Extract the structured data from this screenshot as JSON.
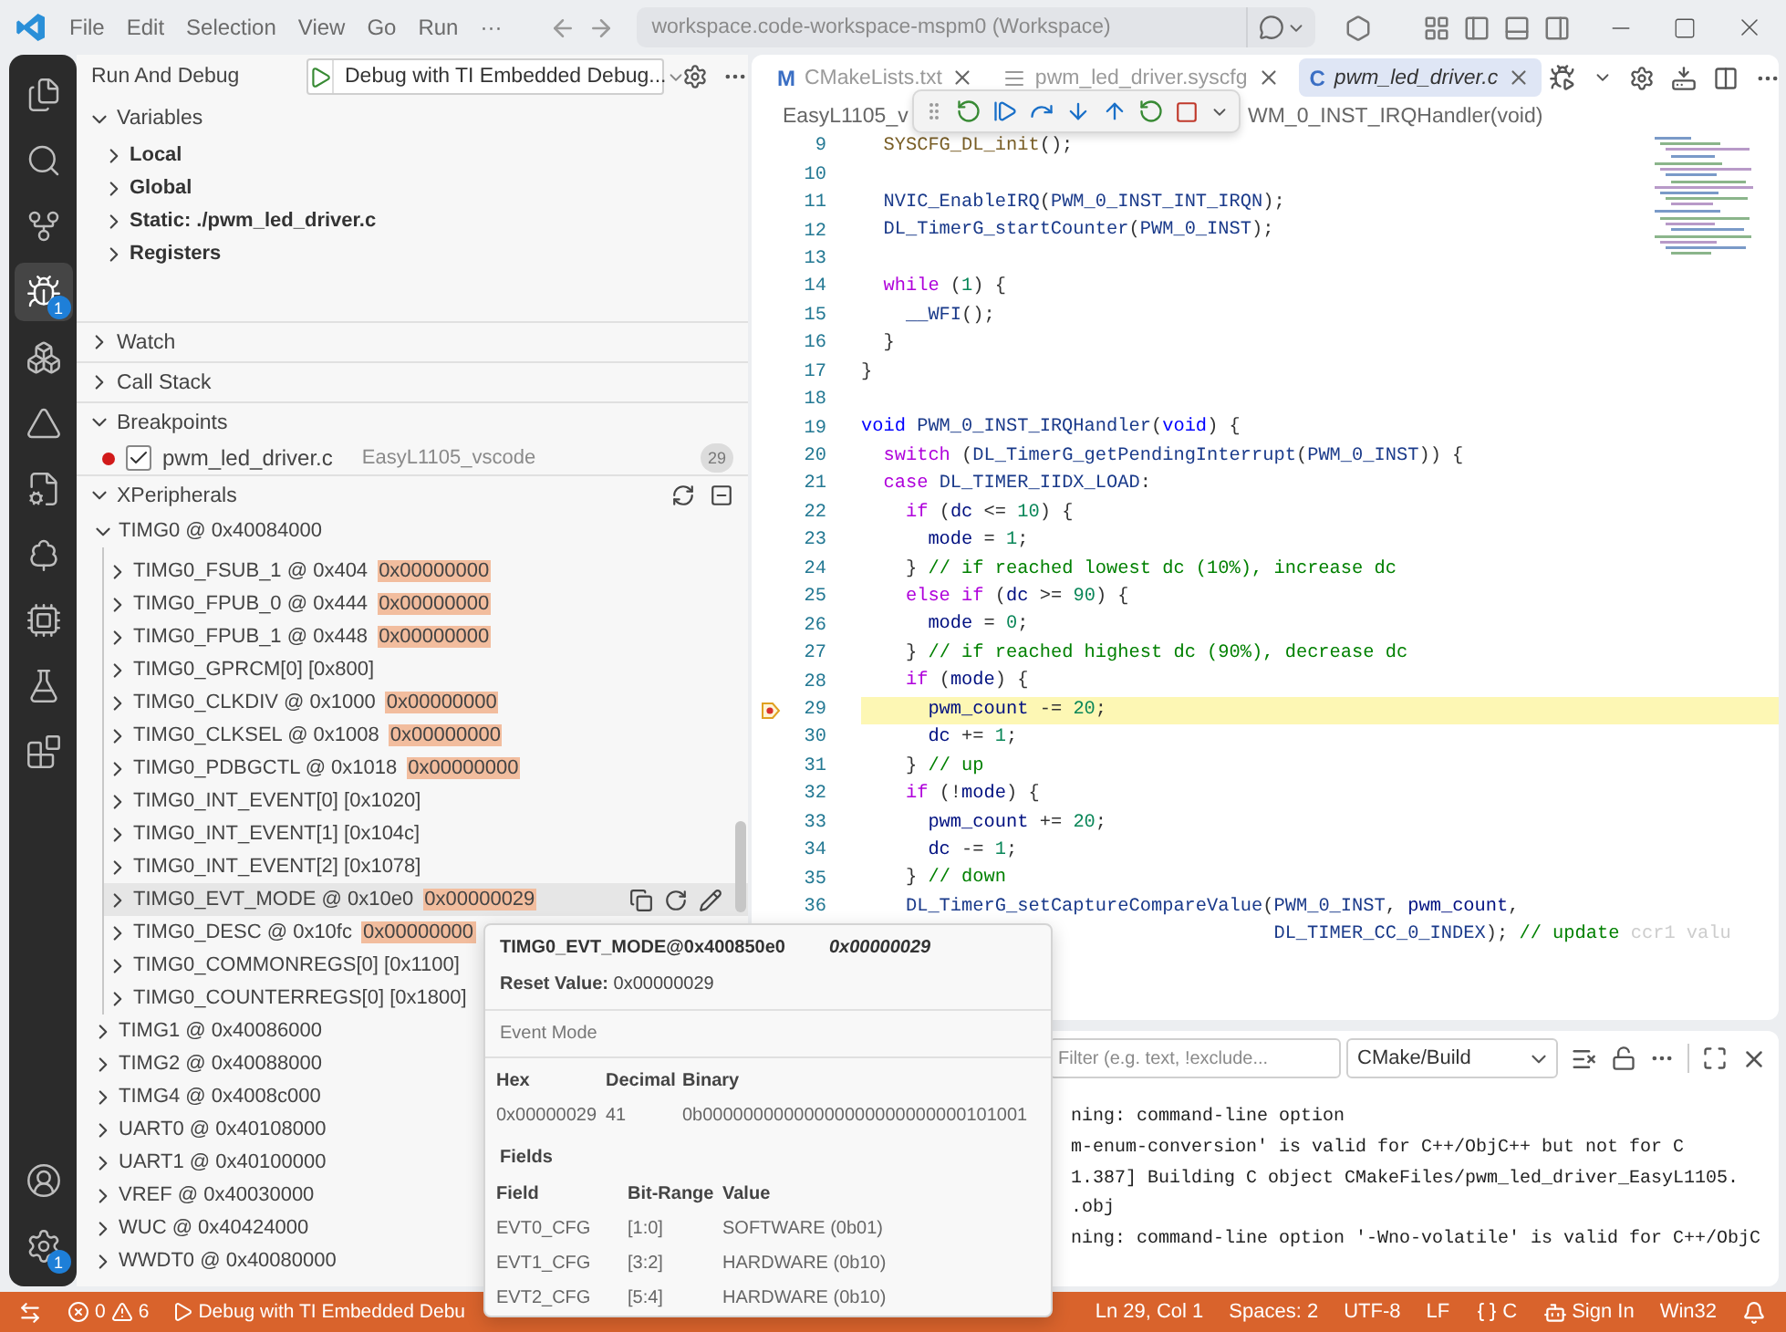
{
  "title_bar": {
    "menus": [
      "File",
      "Edit",
      "Selection",
      "View",
      "Go",
      "Run",
      "···"
    ],
    "command_center": "workspace.code-workspace-mspm0 (Workspace)"
  },
  "activity_bar": {
    "top": [
      {
        "selected": false
      },
      {
        "selected": false
      },
      {
        "selected": false
      },
      {
        "selected": true,
        "badge": "1"
      },
      {
        "selected": false
      },
      {
        "selected": false
      },
      {
        "selected": false
      },
      {
        "selected": false
      },
      {
        "selected": false
      },
      {
        "selected": false
      },
      {
        "selected": false
      }
    ],
    "bottom": [
      {
        "selected": false
      },
      {
        "selected": false,
        "badge": "1"
      }
    ]
  },
  "sidebar": {
    "title": "Run And Debug",
    "launch_config": "Debug with TI Embedded Debug...",
    "variables": {
      "title": "Variables",
      "expanded": true,
      "items": [
        {
          "label": "Local",
          "expanded": false
        },
        {
          "label": "Global",
          "expanded": false
        },
        {
          "label": "Static: ./pwm_led_driver.c",
          "expanded": false
        },
        {
          "label": "Registers",
          "expanded": false
        }
      ]
    },
    "watch": {
      "title": "Watch",
      "expanded": false
    },
    "call_stack": {
      "title": "Call Stack",
      "expanded": false
    },
    "breakpoints": {
      "title": "Breakpoints",
      "expanded": true,
      "items": [
        {
          "file": "pwm_led_driver.c",
          "folder": "EasyL1105_vscode",
          "count": "29",
          "checked": true
        }
      ]
    },
    "xperipherals": {
      "title": "XPeripherals",
      "expanded": true,
      "items": [
        {
          "label": "TIMG0 @ 0x40084000",
          "expanded": true,
          "children": [
            {
              "label": "TIMG0_FSUB_1 @ 0x404",
              "value": "0x00000000",
              "expanded": false,
              "hovered": false
            },
            {
              "label": "TIMG0_FPUB_0 @ 0x444",
              "value": "0x00000000",
              "expanded": false,
              "hovered": false
            },
            {
              "label": "TIMG0_FPUB_1 @ 0x448",
              "value": "0x00000000",
              "expanded": false,
              "hovered": false
            },
            {
              "label": "TIMG0_GPRCM[0] [0x800]",
              "expanded": false,
              "hovered": false
            },
            {
              "label": "TIMG0_CLKDIV @ 0x1000",
              "value": "0x00000000",
              "expanded": false,
              "hovered": false
            },
            {
              "label": "TIMG0_CLKSEL @ 0x1008",
              "value": "0x00000000",
              "expanded": false,
              "hovered": false
            },
            {
              "label": "TIMG0_PDBGCTL @ 0x1018",
              "value": "0x00000000",
              "expanded": false,
              "hovered": false
            },
            {
              "label": "TIMG0_INT_EVENT[0] [0x1020]",
              "expanded": false,
              "hovered": false
            },
            {
              "label": "TIMG0_INT_EVENT[1] [0x104c]",
              "expanded": false,
              "hovered": false
            },
            {
              "label": "TIMG0_INT_EVENT[2] [0x1078]",
              "expanded": false,
              "hovered": false
            },
            {
              "label": "TIMG0_EVT_MODE @ 0x10e0",
              "value": "0x00000029",
              "expanded": false,
              "hovered": true
            },
            {
              "label": "TIMG0_DESC @ 0x10fc",
              "value": "0x00000000",
              "expanded": false,
              "hovered": false
            },
            {
              "label": "TIMG0_COMMONREGS[0] [0x1100]",
              "expanded": false,
              "hovered": false
            },
            {
              "label": "TIMG0_COUNTERREGS[0] [0x1800]",
              "expanded": false,
              "hovered": false
            }
          ]
        },
        {
          "label": "TIMG1 @ 0x40086000",
          "expanded": false
        },
        {
          "label": "TIMG2 @ 0x40088000",
          "expanded": false
        },
        {
          "label": "TIMG4 @ 0x4008c000",
          "expanded": false
        },
        {
          "label": "UART0 @ 0x40108000",
          "expanded": false
        },
        {
          "label": "UART1 @ 0x40100000",
          "expanded": false
        },
        {
          "label": "VREF @ 0x40030000",
          "expanded": false
        },
        {
          "label": "WUC @ 0x40424000",
          "expanded": false
        },
        {
          "label": "WWDT0 @ 0x40080000",
          "expanded": false
        }
      ]
    }
  },
  "editor": {
    "tabs": [
      {
        "label": "CMakeLists.txt",
        "kind": "cmake",
        "glyph": "M",
        "selected": false
      },
      {
        "label": "pwm_led_driver.syscfg",
        "kind": "syscfg",
        "selected": false
      },
      {
        "label": "pwm_led_driver.c",
        "kind": "c",
        "glyph": "C",
        "selected": true
      }
    ],
    "breadcrumb": [
      "EasyL1105_v",
      "WM_0_INST_IRQHandler(void)"
    ],
    "lines": [
      {
        "n": "9",
        "current": false,
        "segs": [
          {
            "text": "  SYSCFG_DL_init",
            "kind": "fn"
          },
          {
            "text": "();",
            "kind": "p"
          }
        ]
      },
      {
        "n": "10",
        "current": false
      },
      {
        "n": "11",
        "current": false,
        "segs": [
          {
            "text": "  NVIC_EnableIRQ",
            "kind": "id"
          },
          {
            "text": "(",
            "kind": "p"
          },
          {
            "text": "PWM_0_INST_INT_IRQN",
            "kind": "id"
          },
          {
            "text": ");",
            "kind": "p"
          }
        ]
      },
      {
        "n": "12",
        "current": false,
        "segs": [
          {
            "text": "  DL_TimerG_startCounter",
            "kind": "id"
          },
          {
            "text": "(",
            "kind": "p"
          },
          {
            "text": "PWM_0_INST",
            "kind": "id"
          },
          {
            "text": ");",
            "kind": "p"
          }
        ]
      },
      {
        "n": "13",
        "current": false
      },
      {
        "n": "14",
        "current": false,
        "segs": [
          {
            "text": "  while",
            "kind": "kw"
          },
          {
            "text": " (",
            "kind": "p"
          },
          {
            "text": "1",
            "kind": "num"
          },
          {
            "text": ") {",
            "kind": "p"
          }
        ]
      },
      {
        "n": "15",
        "current": false,
        "segs": [
          {
            "text": "    __WFI",
            "kind": "id"
          },
          {
            "text": "();",
            "kind": "p"
          }
        ]
      },
      {
        "n": "16",
        "current": false,
        "segs": [
          {
            "text": "  }",
            "kind": "p"
          }
        ]
      },
      {
        "n": "17",
        "current": false,
        "segs": [
          {
            "text": "}",
            "kind": "p"
          }
        ]
      },
      {
        "n": "18",
        "current": false
      },
      {
        "n": "19",
        "current": false,
        "segs": [
          {
            "text": "void",
            "kind": "type"
          },
          {
            "text": " PWM_0_INST_IRQHandler",
            "kind": "id"
          },
          {
            "text": "(",
            "kind": "p"
          },
          {
            "text": "void",
            "kind": "type"
          },
          {
            "text": ") {",
            "kind": "p"
          }
        ]
      },
      {
        "n": "20",
        "current": false,
        "segs": [
          {
            "text": "  switch",
            "kind": "kw"
          },
          {
            "text": " (",
            "kind": "p"
          },
          {
            "text": "DL_TimerG_getPendingInterrupt",
            "kind": "id"
          },
          {
            "text": "(",
            "kind": "p"
          },
          {
            "text": "PWM_0_INST",
            "kind": "id"
          },
          {
            "text": ")) {",
            "kind": "p"
          }
        ]
      },
      {
        "n": "21",
        "current": false,
        "segs": [
          {
            "text": "  case",
            "kind": "kw"
          },
          {
            "text": " DL_TIMER_IIDX_LOAD",
            "kind": "id"
          },
          {
            "text": ":",
            "kind": "p"
          }
        ]
      },
      {
        "n": "22",
        "current": false,
        "segs": [
          {
            "text": "    if",
            "kind": "kw"
          },
          {
            "text": " (",
            "kind": "p"
          },
          {
            "text": "dc",
            "kind": "var"
          },
          {
            "text": " <= ",
            "kind": "p"
          },
          {
            "text": "10",
            "kind": "num"
          },
          {
            "text": ") {",
            "kind": "p"
          }
        ]
      },
      {
        "n": "23",
        "current": false,
        "segs": [
          {
            "text": "      mode",
            "kind": "var"
          },
          {
            "text": " = ",
            "kind": "p"
          },
          {
            "text": "1",
            "kind": "num"
          },
          {
            "text": ";",
            "kind": "p"
          }
        ]
      },
      {
        "n": "24",
        "current": false,
        "segs": [
          {
            "text": "    }",
            "kind": "p"
          },
          {
            "text": " // if reached lowest dc (10%), increase dc",
            "kind": "cm"
          }
        ]
      },
      {
        "n": "25",
        "current": false,
        "segs": [
          {
            "text": "    else if",
            "kind": "kw"
          },
          {
            "text": " (",
            "kind": "p"
          },
          {
            "text": "dc",
            "kind": "var"
          },
          {
            "text": " >= ",
            "kind": "p"
          },
          {
            "text": "90",
            "kind": "num"
          },
          {
            "text": ") {",
            "kind": "p"
          }
        ]
      },
      {
        "n": "26",
        "current": false,
        "segs": [
          {
            "text": "      mode",
            "kind": "var"
          },
          {
            "text": " = ",
            "kind": "p"
          },
          {
            "text": "0",
            "kind": "num"
          },
          {
            "text": ";",
            "kind": "p"
          }
        ]
      },
      {
        "n": "27",
        "current": false,
        "segs": [
          {
            "text": "    }",
            "kind": "p"
          },
          {
            "text": " // if reached highest dc (90%), decrease dc",
            "kind": "cm"
          }
        ]
      },
      {
        "n": "28",
        "current": false,
        "segs": [
          {
            "text": "    if",
            "kind": "kw"
          },
          {
            "text": " (",
            "kind": "p"
          },
          {
            "text": "mode",
            "kind": "var"
          },
          {
            "text": ") {",
            "kind": "p"
          }
        ]
      },
      {
        "n": "29",
        "current": true,
        "segs": [
          {
            "text": "      pwm_count",
            "kind": "var"
          },
          {
            "text": " -= ",
            "kind": "p"
          },
          {
            "text": "20",
            "kind": "num"
          },
          {
            "text": ";",
            "kind": "p"
          }
        ]
      },
      {
        "n": "30",
        "current": false,
        "segs": [
          {
            "text": "      dc",
            "kind": "var"
          },
          {
            "text": " += ",
            "kind": "p"
          },
          {
            "text": "1",
            "kind": "num"
          },
          {
            "text": ";",
            "kind": "p"
          }
        ]
      },
      {
        "n": "31",
        "current": false,
        "segs": [
          {
            "text": "    }",
            "kind": "p"
          },
          {
            "text": " // up",
            "kind": "cm"
          }
        ]
      },
      {
        "n": "32",
        "current": false,
        "segs": [
          {
            "text": "    if",
            "kind": "kw"
          },
          {
            "text": " (!",
            "kind": "p"
          },
          {
            "text": "mode",
            "kind": "var"
          },
          {
            "text": ") {",
            "kind": "p"
          }
        ]
      },
      {
        "n": "33",
        "current": false,
        "segs": [
          {
            "text": "      pwm_count",
            "kind": "var"
          },
          {
            "text": " += ",
            "kind": "p"
          },
          {
            "text": "20",
            "kind": "num"
          },
          {
            "text": ";",
            "kind": "p"
          }
        ]
      },
      {
        "n": "34",
        "current": false,
        "segs": [
          {
            "text": "      dc",
            "kind": "var"
          },
          {
            "text": " -= ",
            "kind": "p"
          },
          {
            "text": "1",
            "kind": "num"
          },
          {
            "text": ";",
            "kind": "p"
          }
        ]
      },
      {
        "n": "35",
        "current": false,
        "segs": [
          {
            "text": "    }",
            "kind": "p"
          },
          {
            "text": " // down",
            "kind": "cm"
          }
        ]
      },
      {
        "n": "36",
        "current": false,
        "segs": [
          {
            "text": "    DL_TimerG_setCaptureCompareValue",
            "kind": "id"
          },
          {
            "text": "(",
            "kind": "p"
          },
          {
            "text": "PWM_0_INST",
            "kind": "id"
          },
          {
            "text": ", ",
            "kind": "p"
          },
          {
            "text": "pwm_count",
            "kind": "var"
          },
          {
            "text": ",",
            "kind": "p"
          }
        ]
      },
      {
        "current": false,
        "segs": [
          {
            "text": "                                     DL_TIMER_CC_0_INDEX",
            "kind": "id"
          },
          {
            "text": "); ",
            "kind": "p"
          },
          {
            "text": "// update",
            "kind": "cm"
          },
          {
            "text": " ccr1 valu",
            "kind": "fade"
          }
        ]
      }
    ]
  },
  "panel": {
    "filter_placeholder": "Filter (e.g. text, !exclude...",
    "channel": "CMake/Build",
    "output": [
      "ning: command-line option",
      "m-enum-conversion' is valid for C++/ObjC++ but not for C",
      "1.387] Building C object CMakeFiles/pwm_led_driver_EasyL1105.",
      ".obj",
      "ning: command-line option '-Wno-volatile' is valid for C++/ObjC"
    ]
  },
  "status_bar": {
    "errors": "0",
    "warnings": "6",
    "debug_config": "Debug with TI Embedded Debu",
    "position": "Ln 29, Col 1",
    "indent": "Spaces: 2",
    "encoding": "UTF-8",
    "eol": "LF",
    "language": "C",
    "account": "Sign In",
    "platform": "Win32"
  },
  "hover": {
    "title": "TIMG0_EVT_MODE@0x400850e0",
    "value": "0x00000029",
    "reset": "**Reset Value:** 0x00000029",
    "description": "Event Mode",
    "formats": {
      "columns": [
        "Hex",
        "Decimal",
        "Binary"
      ],
      "row": [
        "0x00000029",
        "41",
        "0b00000000000000000000000000101001"
      ]
    },
    "fields_title": "Fields",
    "fields": {
      "columns": [
        "Field",
        "Bit-Range",
        "Value"
      ],
      "rows": [
        [
          "EVT0_CFG",
          "[1:0]",
          "SOFTWARE (0b01)"
        ],
        [
          "EVT1_CFG",
          "[3:2]",
          "HARDWARE (0b10)"
        ],
        [
          "EVT2_CFG",
          "[5:4]",
          "HARDWARE (0b10)"
        ]
      ]
    }
  }
}
